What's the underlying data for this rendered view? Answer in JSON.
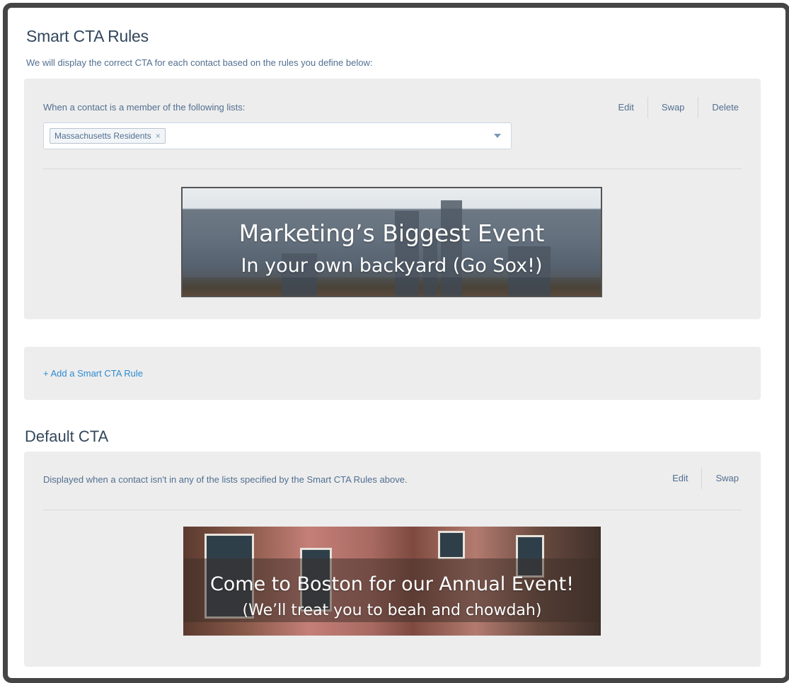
{
  "rules_section": {
    "title": "Smart CTA Rules",
    "subtitle": "We will display the correct CTA for each contact based on the rules you define below:"
  },
  "rule": {
    "condition_label": "When a contact is a member of the following lists:",
    "actions": {
      "edit": "Edit",
      "swap": "Swap",
      "delete": "Delete"
    },
    "selected_list": "Massachusetts Residents",
    "remove_symbol": "×",
    "cta_image": {
      "line1": "Marketing’s Biggest Event",
      "line2": "In your own backyard (Go Sox!)"
    }
  },
  "add_rule": {
    "label": "+ Add a Smart CTA Rule"
  },
  "default_section": {
    "title": "Default CTA",
    "description": "Displayed when a contact isn't in any of the lists specified by the Smart CTA Rules above.",
    "actions": {
      "edit": "Edit",
      "swap": "Swap"
    },
    "cta_image": {
      "line1": "Come to Boston for our Annual Event!",
      "line2": "(We’ll treat you to beah and chowdah)"
    }
  },
  "colors": {
    "panel_bg": "#ededed",
    "link": "#2f8ccf",
    "text": "#33475b",
    "frame_border": "#454545"
  }
}
